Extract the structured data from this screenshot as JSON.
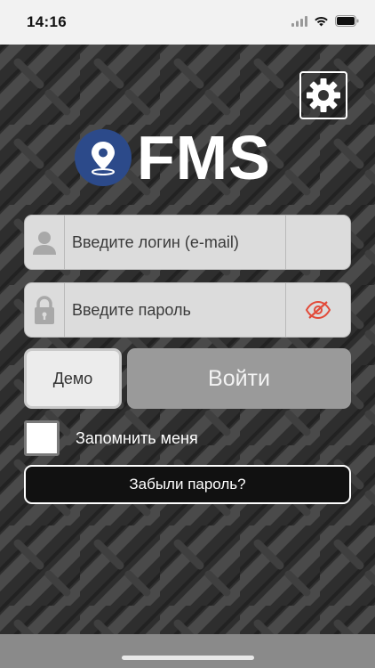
{
  "status_bar": {
    "time": "14:16"
  },
  "logo": {
    "text": "FMS",
    "brand_color": "#2c4a8a"
  },
  "login_field": {
    "placeholder": "Введите логин (e-mail)",
    "value": "",
    "icon": "user-icon"
  },
  "password_field": {
    "placeholder": "Введите пароль",
    "value": "",
    "icon": "lock-icon",
    "toggle_icon": "eye-slash-icon"
  },
  "buttons": {
    "demo_label": "Демо",
    "login_label": "Войти",
    "forgot_label": "Забыли пароль?"
  },
  "remember": {
    "label": "Запомнить меня",
    "checked": false
  },
  "settings": {
    "icon": "gear-icon"
  }
}
